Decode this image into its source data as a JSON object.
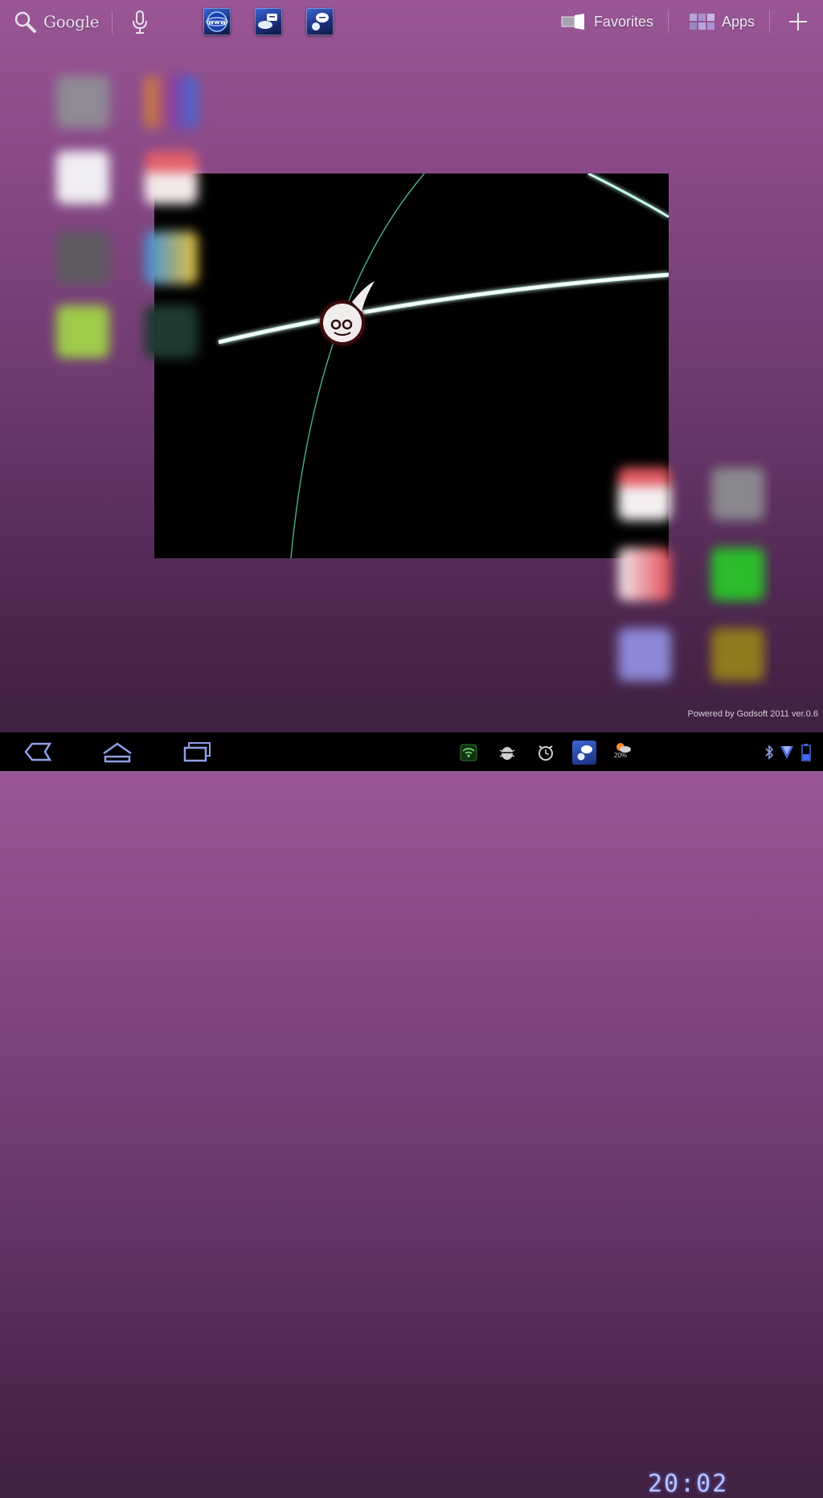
{
  "top_bar": {
    "search_label": "Google",
    "favorites_label": "Favorites",
    "apps_label": "Apps",
    "icons": {
      "search": "search-icon",
      "voice": "microphone-icon",
      "browser": "www-globe-icon",
      "chat_1": "chat-bubble-icon",
      "chat_2": "chat-bubble-icon",
      "favorites": "folder-icon",
      "apps": "apps-grid-icon",
      "add": "plus-icon"
    }
  },
  "widget": {
    "footer_text": "Powered by Godsoft 2011 ver.0.6"
  },
  "system_bar": {
    "clock": "20:02",
    "battery_label": "20%",
    "icons": {
      "back": "back-icon",
      "home": "home-icon",
      "recents": "recent-apps-icon",
      "wifi": "wifi-icon",
      "bug": "android-debug-icon",
      "alarm": "alarm-clock-icon",
      "chat": "chat-bubble-icon",
      "weather": "weather-icon",
      "bluetooth": "bluetooth-icon",
      "signal": "signal-icon",
      "battery": "battery-icon"
    }
  },
  "colors": {
    "background_top": "#9a5696",
    "background_bottom": "#3a1e3c",
    "clock": "#b9c3ff",
    "widget_bg": "#000000"
  }
}
